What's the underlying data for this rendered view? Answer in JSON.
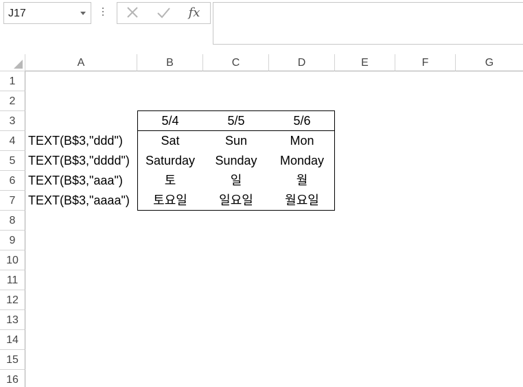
{
  "name_box": {
    "value": "J17"
  },
  "formula_bar": {
    "fx_label": "fx",
    "value": ""
  },
  "columns": [
    "A",
    "B",
    "C",
    "D",
    "E",
    "F",
    "G"
  ],
  "rows": [
    "1",
    "2",
    "3",
    "4",
    "5",
    "6",
    "7",
    "8",
    "9",
    "10",
    "11",
    "12",
    "13",
    "14",
    "15",
    "16"
  ],
  "cells": {
    "B3": "5/4",
    "C3": "5/5",
    "D3": "5/6",
    "A4": "TEXT(B$3,\"ddd\")",
    "B4": "Sat",
    "C4": "Sun",
    "D4": "Mon",
    "A5": "TEXT(B$3,\"dddd\")",
    "B5": "Saturday",
    "C5": "Sunday",
    "D5": "Monday",
    "A6": "TEXT(B$3,\"aaa\")",
    "B6": "토",
    "C6": "일",
    "D6": "월",
    "A7": "TEXT(B$3,\"aaaa\")",
    "B7": "토요일",
    "C7": "일요일",
    "D7": "월요일"
  }
}
